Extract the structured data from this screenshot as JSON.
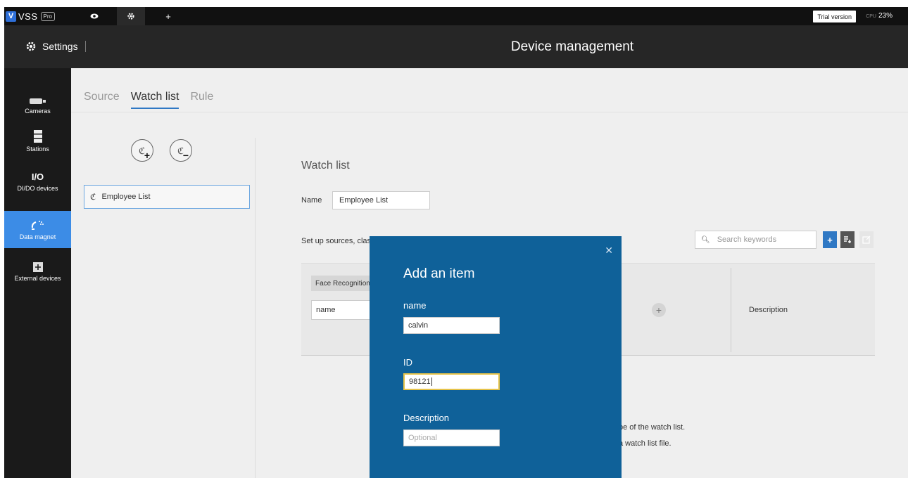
{
  "topbar": {
    "logo_text": "VSS",
    "logo_badge": "Pro",
    "tabs": [
      {
        "icon": "eye-icon",
        "glyph": "👁"
      },
      {
        "icon": "gear-icon",
        "glyph": "✱"
      },
      {
        "icon": "plus-icon",
        "glyph": "+"
      }
    ],
    "trial_label": "Trial version",
    "cpu_label": "CPU",
    "cpu_value": "23%"
  },
  "header": {
    "settings_label": "Settings",
    "page_title": "Device management"
  },
  "sidebar": {
    "items": [
      {
        "label": "Cameras",
        "icon": "camera-icon"
      },
      {
        "label": "Stations",
        "icon": "server-icon"
      },
      {
        "label": "DI/DO devices",
        "icon": "io-icon",
        "icon_text": "I/O"
      },
      {
        "label": "Data magnet",
        "icon": "magnet-icon",
        "active": true
      },
      {
        "label": "External devices",
        "icon": "external-device-icon"
      }
    ]
  },
  "subtabs": [
    "Source",
    "Watch list",
    "Rule"
  ],
  "list": {
    "items": [
      "Employee List"
    ]
  },
  "watchlist": {
    "title": "Watch list",
    "name_label": "Name",
    "name_value": "Employee List",
    "setup_text": "Set up sources, classifi",
    "search_placeholder": "Search keywords",
    "face_chip": "Face Recognition,",
    "name_cell": "name",
    "description_col": "Description",
    "hint1": "pe of the watch list.",
    "hint2": "a watch list file."
  },
  "modal": {
    "title": "Add an item",
    "name_label": "name",
    "name_value": "calvin",
    "id_label": "ID",
    "id_value": "98121",
    "desc_label": "Description",
    "desc_placeholder": "Optional"
  },
  "colors": {
    "accent": "#2f78c4",
    "sidebar_active": "#3c8ce6",
    "modal_bg": "#0f6199",
    "focus_border": "#e6c34a"
  }
}
